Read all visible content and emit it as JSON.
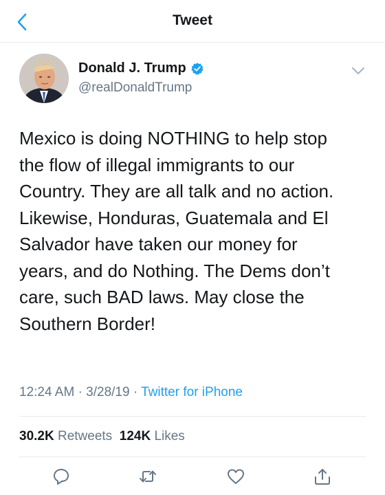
{
  "header": {
    "title": "Tweet"
  },
  "tweet": {
    "author": {
      "name": "Donald J. Trump",
      "handle": "@realDonaldTrump",
      "verified": true
    },
    "lines": [
      "Mexico is doing NOTHING to help stop",
      "the flow of illegal immigrants to our",
      "Country. They are all talk and no action.",
      "Likewise, Honduras, Guatemala and El",
      "Salvador have taken our money for",
      "years, and do Nothing. The Dems don’t",
      "care, such BAD laws. May close the",
      "Southern Border!"
    ],
    "time": "12:24 AM",
    "date": "3/28/19",
    "separator": "·",
    "source": "Twitter for iPhone",
    "retweets_count": "30.2K",
    "retweets_label": "Retweets",
    "likes_count": "124K",
    "likes_label": "Likes"
  },
  "colors": {
    "accent": "#1da1f2",
    "muted": "#657786",
    "text": "#14171a",
    "divider": "#e6ecf0"
  },
  "icons": {
    "back": "chevron-left-icon",
    "verified": "verified-badge-icon",
    "more": "chevron-down-icon",
    "reply": "reply-icon",
    "retweet": "retweet-icon",
    "like": "heart-icon",
    "share": "share-icon"
  }
}
